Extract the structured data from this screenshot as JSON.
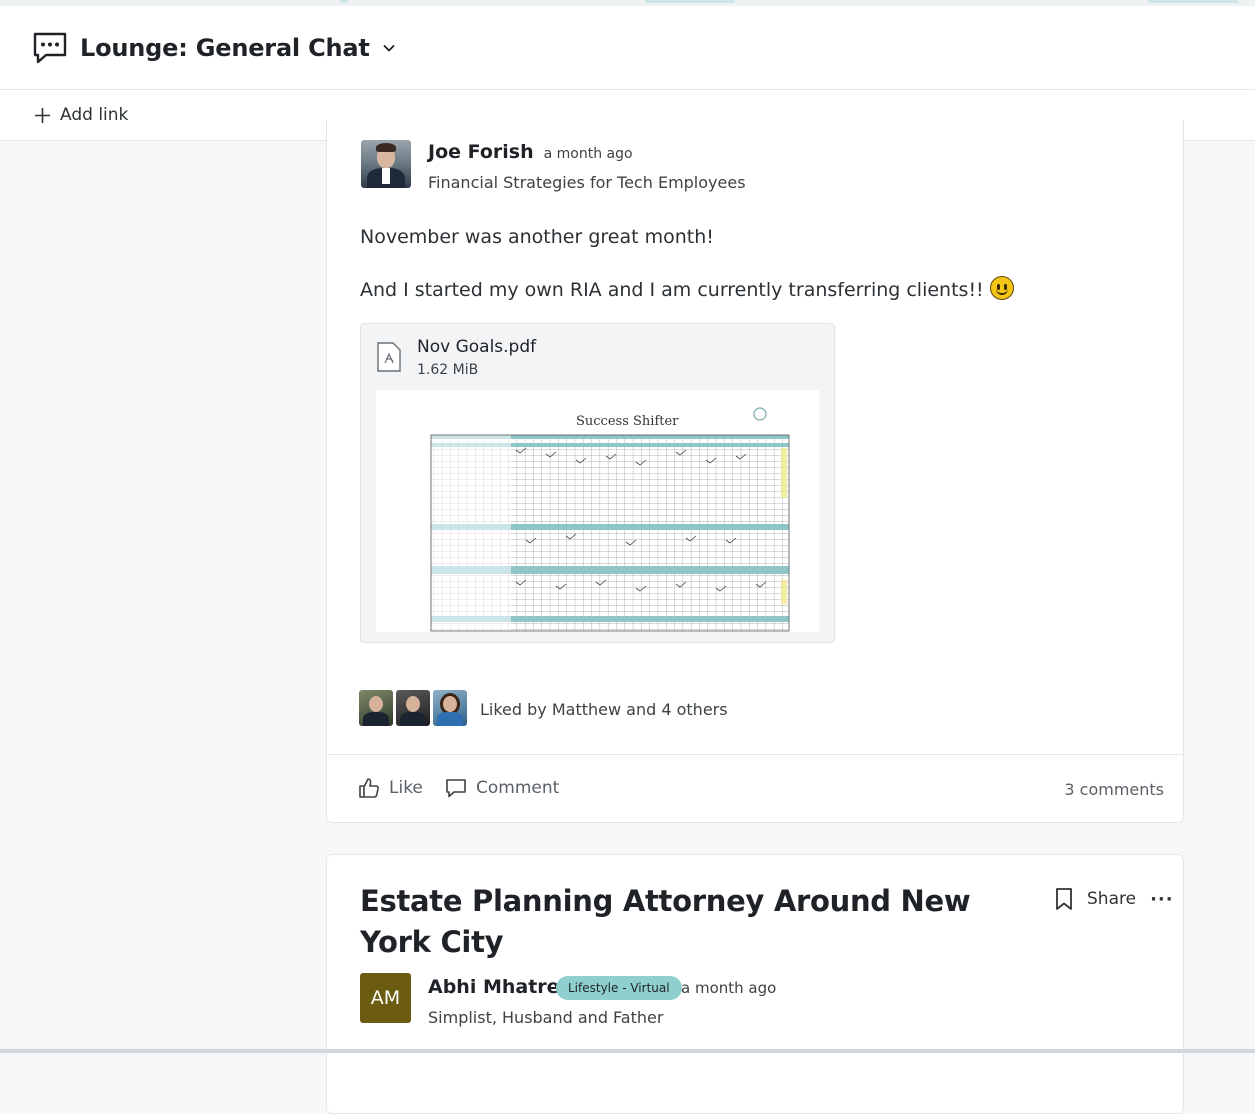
{
  "header": {
    "title": "Lounge: General Chat",
    "chat_icon": "chat-bubble-icon",
    "dropdown_icon": "chevron-down-icon"
  },
  "linkbar": {
    "add_link_label": "Add link"
  },
  "post1": {
    "author": "Joe Forish",
    "time": "a month ago",
    "subtitle": "Financial Strategies for Tech Employees",
    "paragraphs": [
      "November was another great month!",
      "And I started my own RIA and I am currently transferring clients!!"
    ],
    "attachment": {
      "file_name": "Nov Goals.pdf",
      "file_size": "1.62 MiB",
      "preview_title": "Success Shifter"
    },
    "liked_by": "Liked by Matthew and 4 others",
    "actions": {
      "like": "Like",
      "comment": "Comment",
      "comments_count": "3 comments"
    }
  },
  "post2": {
    "title": "Estate Planning Attorney Around New York City",
    "share_label": "Share",
    "more_label": "···",
    "author_initials": "AM",
    "author": "Abhi Mhatre",
    "badge": "Lifestyle - Virtual",
    "time": "a month ago",
    "subtitle": "Simplist, Husband and Father"
  },
  "colors": {
    "badge_bg": "#8fd0cf",
    "initials_bg": "#6b5c12",
    "teal_accent": "#8fc7c9"
  }
}
